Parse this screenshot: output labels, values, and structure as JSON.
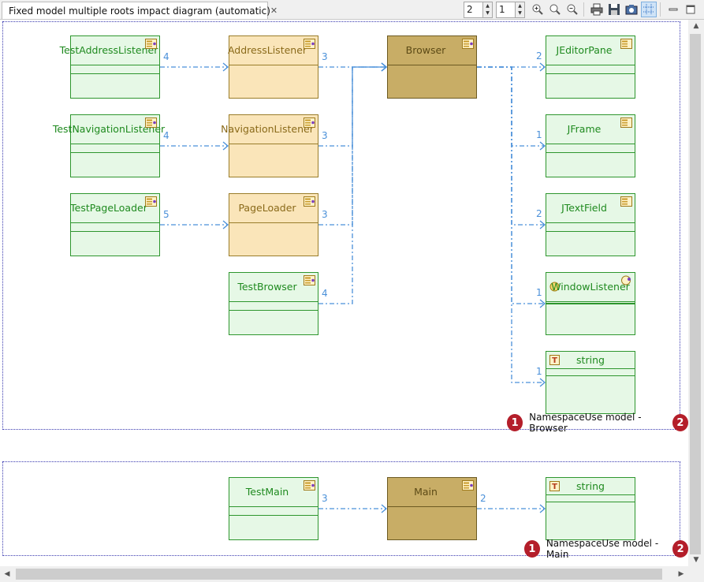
{
  "editor_tab": {
    "title": "Fixed model multiple roots impact diagram (automatic)",
    "close_glyph": "✕",
    "icon": "diagram-icon"
  },
  "toolbar": {
    "depth_value": "2",
    "level_value": "1",
    "buttons": [
      "zoom-in-icon",
      "zoom-fit-icon",
      "zoom-out-icon",
      "print-icon",
      "save-icon",
      "export-image-icon",
      "grid-icon"
    ],
    "window_controls": [
      "minimize-icon",
      "maximize-icon"
    ]
  },
  "colors": {
    "test_node": "#e6f8e6",
    "impacted_node": "#fae5b9",
    "root_node": "#c8ad66",
    "edge": "#4a90d9",
    "badge": "#b41e2a"
  },
  "groups": [
    {
      "caption": "NamespaceUse model - Browser",
      "badge_left": "1",
      "badge_right": "2",
      "nodes": [
        {
          "id": "testaddresslistener",
          "label": "TestAddressListener",
          "kind": "test"
        },
        {
          "id": "testnavigationlistener",
          "label": "TestNavigationListener",
          "kind": "test"
        },
        {
          "id": "testpageloader",
          "label": "TestPageLoader",
          "kind": "test"
        },
        {
          "id": "addresslistener",
          "label": "AddressListener",
          "kind": "impacted"
        },
        {
          "id": "navigationlistener",
          "label": "NavigationListener",
          "kind": "impacted"
        },
        {
          "id": "pageloader",
          "label": "PageLoader",
          "kind": "impacted"
        },
        {
          "id": "testbrowser",
          "label": "TestBrowser",
          "kind": "test"
        },
        {
          "id": "browser",
          "label": "Browser",
          "kind": "root"
        },
        {
          "id": "jeditorpane",
          "label": "JEditorPane",
          "kind": "test"
        },
        {
          "id": "jframe",
          "label": "JFrame",
          "kind": "test"
        },
        {
          "id": "jtextfield",
          "label": "JTextField",
          "kind": "test"
        },
        {
          "id": "windowlistener",
          "label": "WindowListener",
          "kind": "interface"
        },
        {
          "id": "string",
          "label": "string",
          "kind": "type"
        }
      ],
      "edges": [
        {
          "from": "testaddresslistener",
          "to": "addresslistener",
          "label": "4"
        },
        {
          "from": "testnavigationlistener",
          "to": "navigationlistener",
          "label": "4"
        },
        {
          "from": "testpageloader",
          "to": "pageloader",
          "label": "5"
        },
        {
          "from": "addresslistener",
          "to": "browser",
          "label": "3"
        },
        {
          "from": "navigationlistener",
          "to": "browser",
          "label": "3"
        },
        {
          "from": "pageloader",
          "to": "browser",
          "label": "3"
        },
        {
          "from": "testbrowser",
          "to": "browser",
          "label": "4"
        },
        {
          "from": "browser",
          "to": "jeditorpane",
          "label": "2"
        },
        {
          "from": "browser",
          "to": "jframe",
          "label": "1"
        },
        {
          "from": "browser",
          "to": "jtextfield",
          "label": "2"
        },
        {
          "from": "browser",
          "to": "windowlistener",
          "label": "1"
        },
        {
          "from": "browser",
          "to": "string",
          "label": "1"
        }
      ]
    },
    {
      "caption": "NamespaceUse model - Main",
      "badge_left": "1",
      "badge_right": "2",
      "nodes": [
        {
          "id": "testmain",
          "label": "TestMain",
          "kind": "test"
        },
        {
          "id": "main",
          "label": "Main",
          "kind": "root"
        },
        {
          "id": "string2",
          "label": "string",
          "kind": "type"
        }
      ],
      "edges": [
        {
          "from": "testmain",
          "to": "main",
          "label": "3"
        },
        {
          "from": "main",
          "to": "string2",
          "label": "2"
        }
      ]
    }
  ]
}
